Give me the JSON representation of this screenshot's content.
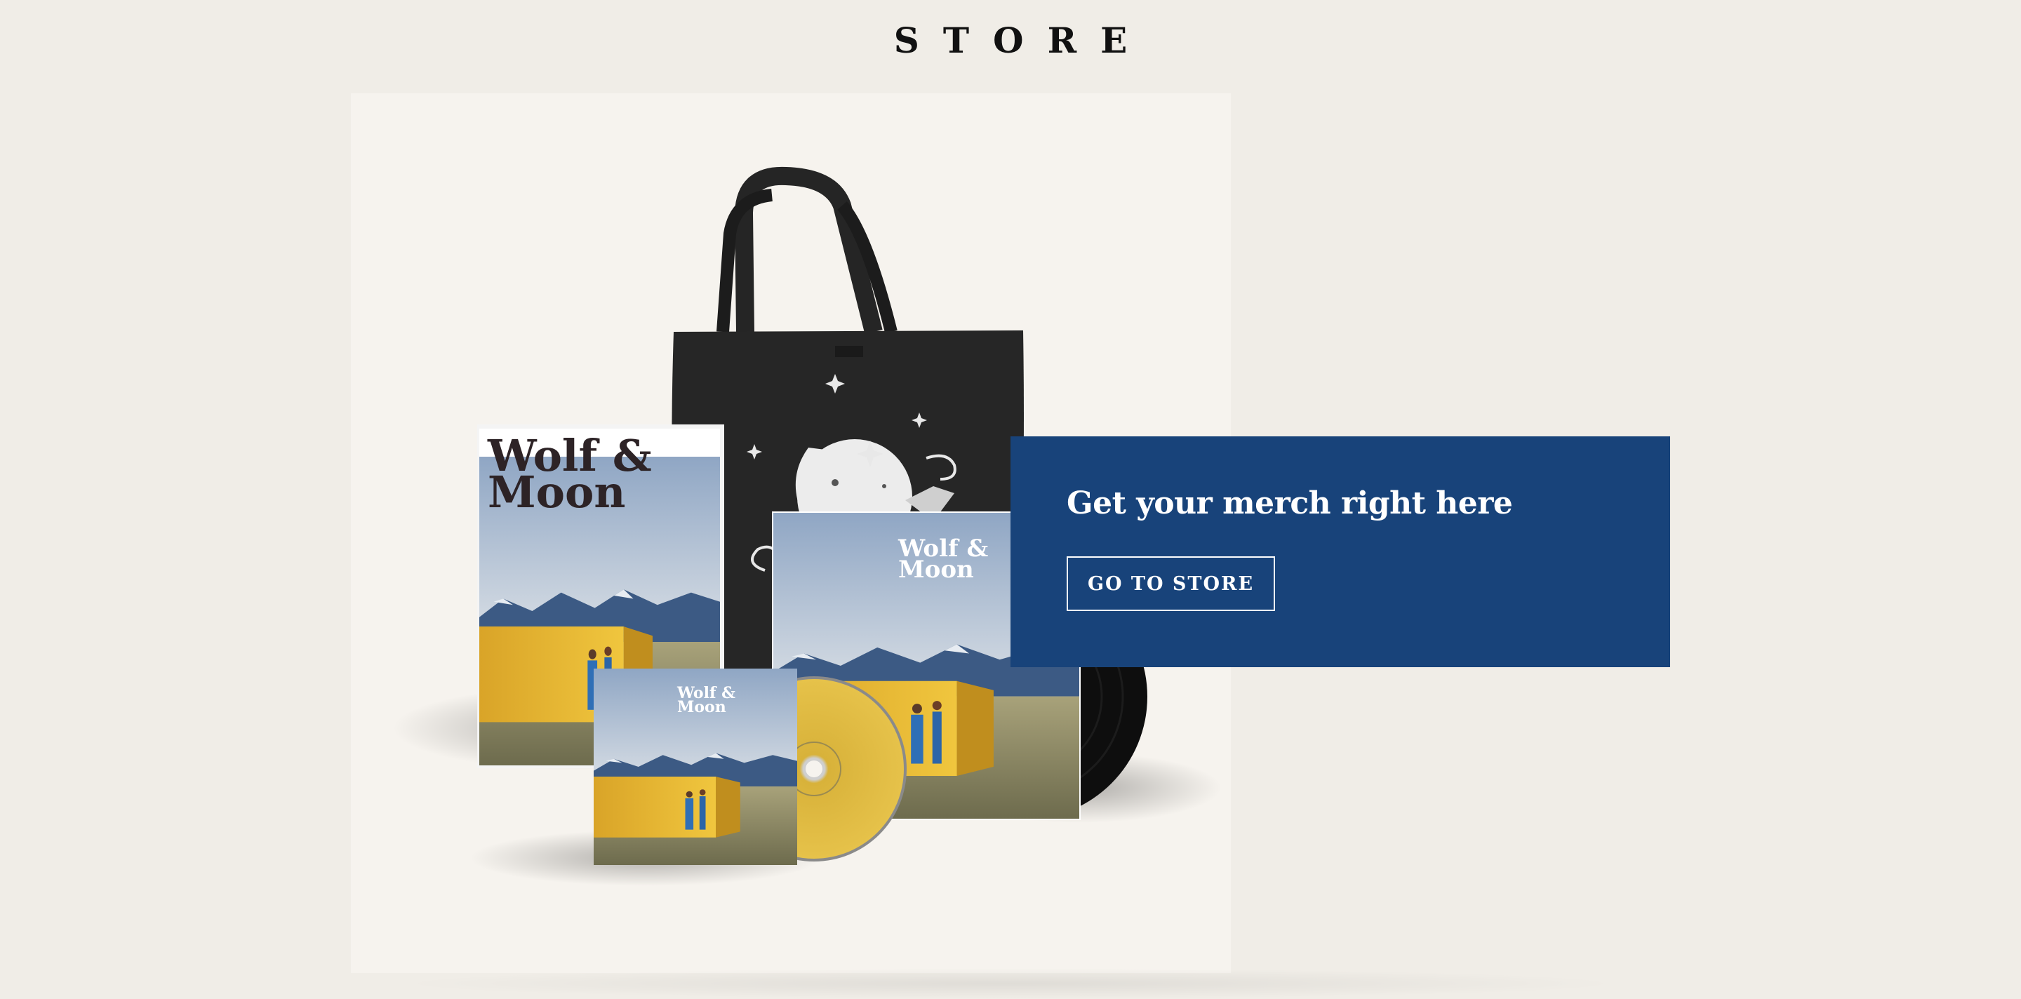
{
  "header": {
    "title": "STORE"
  },
  "promo": {
    "heading": "Get your merch right here",
    "button_label": "GO TO STORE",
    "background": "#18437a"
  },
  "products": {
    "brand_logo_line1": "Wolf &",
    "brand_logo_line2": "Moon"
  },
  "colors": {
    "page_background": "#f0ede7",
    "frame_background": "#f6f3ee",
    "accent_yellow": "#e2b634",
    "tote_black": "#262626"
  }
}
